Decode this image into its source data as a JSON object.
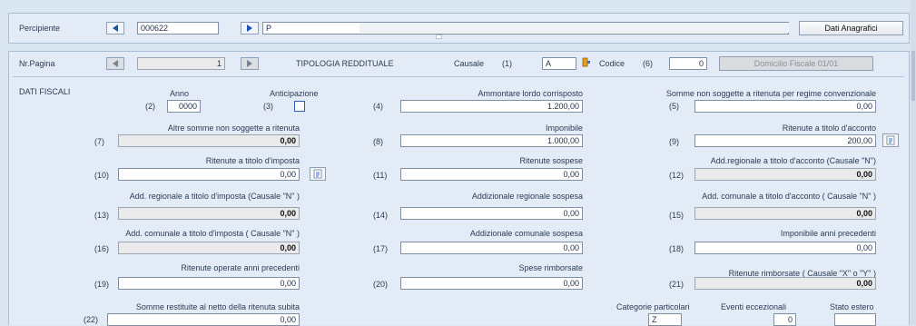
{
  "header": {
    "percipiente_label": "Percipiente",
    "code_value": "000622",
    "name_value": "P",
    "dati_anagrafici_label": "Dati Anagrafici"
  },
  "nav": {
    "nr_pagina_label": "Nr.Pagina",
    "page_value": "1",
    "tipologia_label": "TIPOLOGIA REDDITUALE",
    "causale_label": "Causale",
    "causale_num": "(1)",
    "causale_value": "A",
    "codice_label": "Codice",
    "codice_num": "(6)",
    "codice_value": "0",
    "domicilio_label": "Domicilio Fiscale 01/01"
  },
  "section_title": "DATI FISCALI",
  "anno": {
    "num": "(2)",
    "label": "Anno",
    "value": "0000"
  },
  "anticipazione": {
    "num": "(3)",
    "label": "Anticipazione",
    "checked": false
  },
  "fields": {
    "f4": {
      "num": "(4)",
      "label": "Ammontare lordo corrisposto",
      "value": "1.200,00"
    },
    "f5": {
      "num": "(5)",
      "label": "Somme non soggette a ritenuta per regime convenzionale",
      "value": "0,00"
    },
    "f7": {
      "num": "(7)",
      "label": "Altre somme non soggette a ritenuta",
      "value": "0,00"
    },
    "f8": {
      "num": "(8)",
      "label": "Imponibile",
      "value": "1.000,00"
    },
    "f9": {
      "num": "(9)",
      "label": "Ritenute a titolo d'acconto",
      "value": "200,00"
    },
    "f10": {
      "num": "(10)",
      "label": "Ritenute a titolo d'imposta",
      "value": "0,00"
    },
    "f11": {
      "num": "(11)",
      "label": "Ritenute sospese",
      "value": "0,00"
    },
    "f12": {
      "num": "(12)",
      "label": "Add.regionale a titolo d'acconto (Causale \"N\")",
      "value": "0,00"
    },
    "f13": {
      "num": "(13)",
      "label": "Add. regionale a titolo d'imposta (Causale \"N\" )",
      "value": "0,00"
    },
    "f14": {
      "num": "(14)",
      "label": "Addizionale regionale sospesa",
      "value": "0,00"
    },
    "f15": {
      "num": "(15)",
      "label": "Add. comunale a titolo d'acconto ( Causale \"N\" )",
      "value": "0,00"
    },
    "f16": {
      "num": "(16)",
      "label": "Add. comunale a titolo d'imposta ( Causale \"N\" )",
      "value": "0,00"
    },
    "f17": {
      "num": "(17)",
      "label": "Addizionale comunale sospesa",
      "value": "0,00"
    },
    "f18": {
      "num": "(18)",
      "label": "Imponibile anni precedenti",
      "value": "0,00"
    },
    "f19": {
      "num": "(19)",
      "label": "Ritenute operate anni precedenti",
      "value": "0,00"
    },
    "f20": {
      "num": "(20)",
      "label": "Spese rimborsate",
      "value": "0,00"
    },
    "f21": {
      "num": "(21)",
      "label": "Ritenute rimborsate ( Causale \"X\" o \"Y\" )",
      "value": "0,00"
    },
    "f22": {
      "num": "(22)",
      "label": "Somme restituite al netto della ritenuta subita",
      "value": "0,00"
    }
  },
  "bottom": {
    "categorie_label": "Categorie particolari",
    "categorie_value": "Z",
    "eventi_label": "Eventi eccezionali",
    "eventi_value": "0",
    "stato_label": "Stato estero",
    "stato_value": ""
  }
}
